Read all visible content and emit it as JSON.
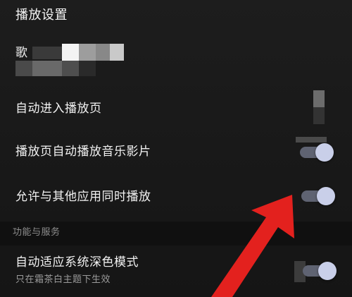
{
  "settings": {
    "section_title": "播放设置",
    "lyrics_row_partial_label": "歌",
    "auto_enter_play_page_label": "自动进入播放页",
    "autoplay_music_video_label": "播放页自动播放音乐影片",
    "autoplay_music_video_on": true,
    "allow_simultaneous_label": "允许与其他应用同时播放",
    "allow_simultaneous_on": true,
    "group_functions_label": "功能与服务",
    "dark_mode_label": "自动适应系统深色模式",
    "dark_mode_sub": "只在霜茶白主题下生效",
    "dark_mode_on": true
  },
  "colors": {
    "toggle_thumb": "#c9cfe9",
    "toggle_track": "#5f6372",
    "arrow": "#e3211e",
    "background": "#161616"
  }
}
